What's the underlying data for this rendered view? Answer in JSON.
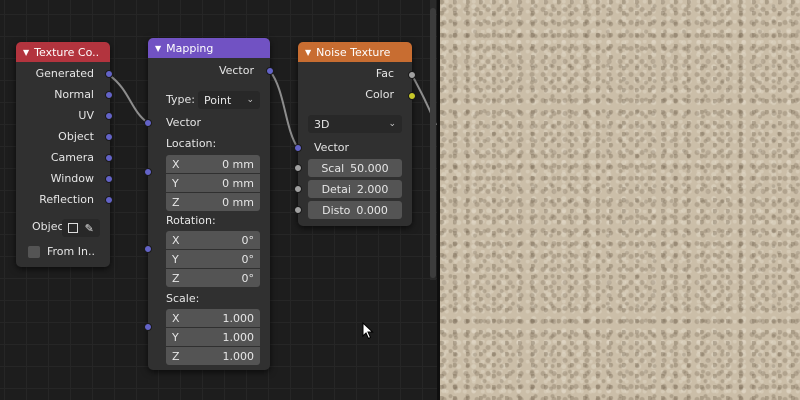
{
  "colors": {
    "texture_coordinate_header": "#b3343e",
    "mapping_header": "#7152c3",
    "noise_texture_header": "#c86d31",
    "vector_socket": "#6363c7",
    "float_socket": "#a1a1a1",
    "color_socket": "#c7c729",
    "node_body": "#303030",
    "field": "#545454",
    "texture_preview": "#cbbea8"
  },
  "texture_coordinate_node": {
    "title": "Texture Co..",
    "outputs": [
      "Generated",
      "Normal",
      "UV",
      "Object",
      "Camera",
      "Window",
      "Reflection"
    ],
    "object_label": "Objec",
    "object_buttons": [
      "object-icon",
      "eyedropper-icon"
    ],
    "from_instancer_label": "From In..",
    "from_instancer_checked": false
  },
  "mapping_node": {
    "title": "Mapping",
    "output_label": "Vector",
    "type_label": "Type:",
    "type_value": "Point",
    "vector_input_label": "Vector",
    "location_label": "Location:",
    "location": [
      {
        "axis": "X",
        "value": "0 mm"
      },
      {
        "axis": "Y",
        "value": "0 mm"
      },
      {
        "axis": "Z",
        "value": "0 mm"
      }
    ],
    "rotation_label": "Rotation:",
    "rotation": [
      {
        "axis": "X",
        "value": "0°"
      },
      {
        "axis": "Y",
        "value": "0°"
      },
      {
        "axis": "Z",
        "value": "0°"
      }
    ],
    "scale_label": "Scale:",
    "scale": [
      {
        "axis": "X",
        "value": "1.000"
      },
      {
        "axis": "Y",
        "value": "1.000"
      },
      {
        "axis": "Z",
        "value": "1.000"
      }
    ]
  },
  "noise_texture_node": {
    "title": "Noise Texture",
    "outputs": [
      "Fac",
      "Color"
    ],
    "dimensions_value": "3D",
    "vector_input_label": "Vector",
    "inputs": [
      {
        "label": "Scal",
        "value": "50.000"
      },
      {
        "label": "Detai",
        "value": "2.000"
      },
      {
        "label": "Disto",
        "value": "0.000"
      }
    ]
  },
  "icons": {
    "collapse": "chevron-down-icon",
    "dropdown": "chevron-down-icon",
    "cursor": "mouse-pointer-icon"
  }
}
